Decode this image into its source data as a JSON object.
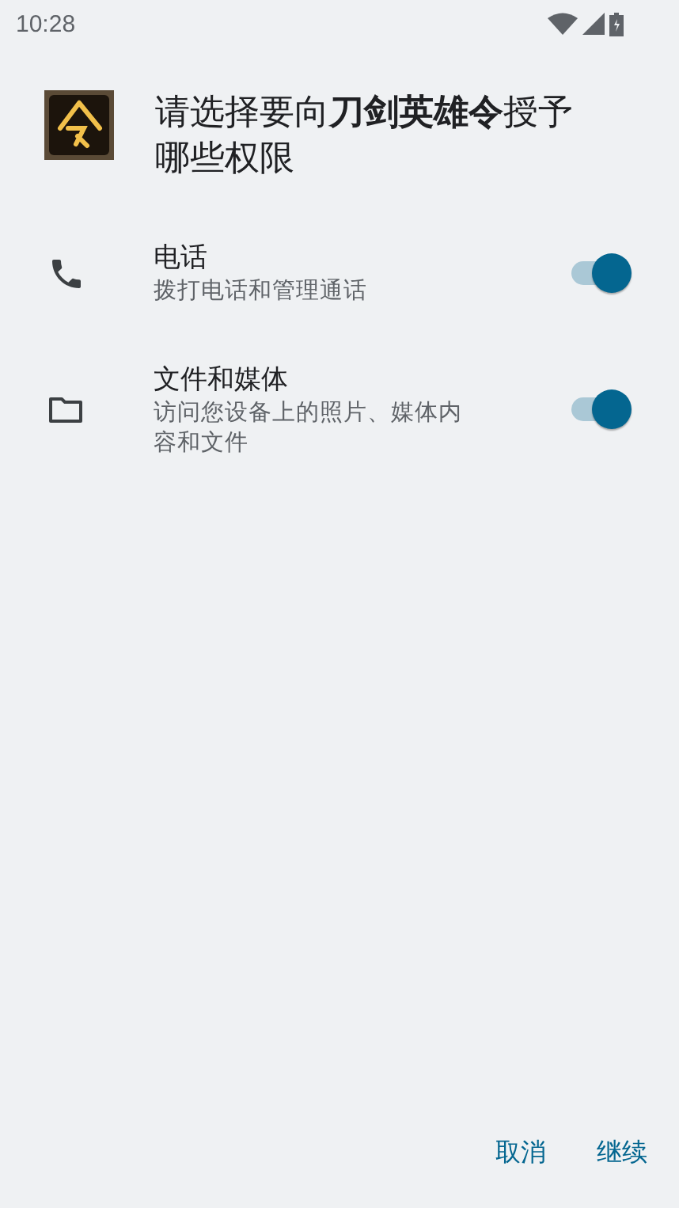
{
  "status_bar": {
    "time": "10:28"
  },
  "dialog": {
    "title": "请选择要向**刀剑英雄令**授予哪些权限",
    "permissions": [
      {
        "kind": "phone",
        "title": "电话",
        "description": "拨打电话和管理通话",
        "on": true
      },
      {
        "kind": "folder",
        "title": "文件和媒体",
        "description": "访问您设备上的照片、媒体内容和文件",
        "on": true
      }
    ],
    "buttons": [
      "取消",
      "继续"
    ]
  }
}
